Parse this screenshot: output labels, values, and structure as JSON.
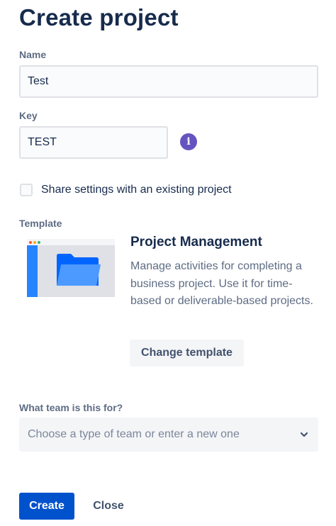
{
  "page": {
    "title": "Create project"
  },
  "form": {
    "name": {
      "label": "Name",
      "value": "Test"
    },
    "key": {
      "label": "Key",
      "value": "TEST",
      "info_icon": "info-icon"
    },
    "share_settings": {
      "label": "Share settings with an existing project",
      "checked": false
    },
    "template": {
      "label": "Template",
      "title": "Project Management",
      "description": "Manage activities for completing a business project. Use it for time-based or deliverable-based projects.",
      "change_label": "Change template",
      "thumbnail_icon": "folder-icon"
    },
    "team": {
      "label": "What team is this for?",
      "placeholder": "Choose a type of team or enter a new one",
      "icon": "chevron-down-icon"
    }
  },
  "actions": {
    "create_label": "Create",
    "close_label": "Close"
  },
  "colors": {
    "primary": "#0052cc",
    "info": "#6554c0",
    "text": "#172b4d",
    "subtle_text": "#5e6c84",
    "field_border": "#dfe1e6",
    "template_accent": "#2684ff"
  }
}
